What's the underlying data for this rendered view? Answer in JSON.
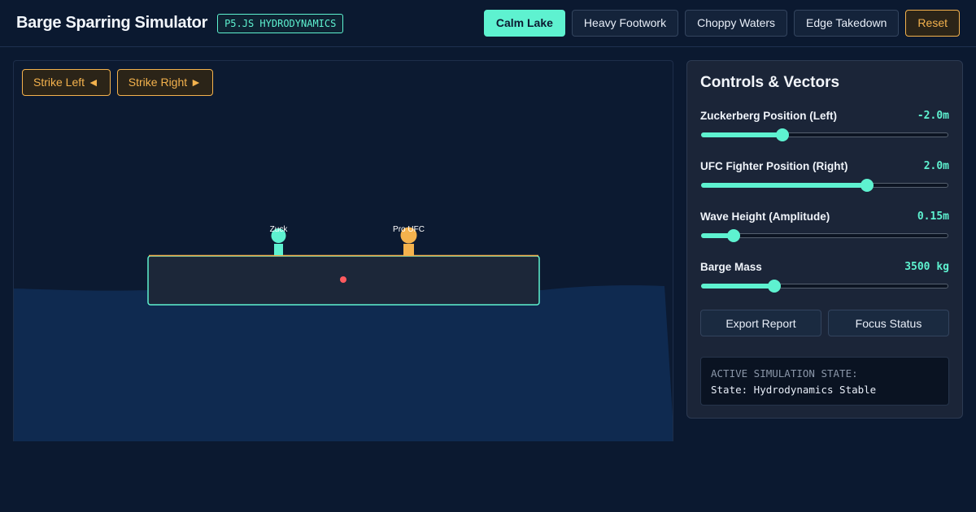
{
  "header": {
    "title": "Barge Sparring Simulator",
    "tag": "P5.JS HYDRODYNAMICS",
    "nav": [
      "Calm Lake",
      "Heavy Footwork",
      "Choppy Waters",
      "Edge Takedown",
      "Reset"
    ]
  },
  "stage": {
    "strike_left": "Strike Left ◄",
    "strike_right": "Strike Right ►",
    "fighter_left_label": "Zuck",
    "fighter_right_label": "Pro UFC",
    "colors": {
      "water": "#0f2a50",
      "barge": "#1c2739",
      "barge_outline": "#5ef2d0",
      "deck": "#f4b24d",
      "left_fighter": "#5ef2d0",
      "right_fighter": "#f4b24d",
      "center_of_mass": "#ff5a5f"
    }
  },
  "panel": {
    "title": "Controls & Vectors",
    "controls": [
      {
        "label": "Zuckerberg Position (Left)",
        "value": "-2.0m",
        "fraction": 0.32
      },
      {
        "label": "UFC Fighter Position (Right)",
        "value": "2.0m",
        "fraction": 0.68
      },
      {
        "label": "Wave Height (Amplitude)",
        "value": "0.15m",
        "fraction": 0.115
      },
      {
        "label": "Barge Mass",
        "value": "3500 kg",
        "fraction": 0.285
      }
    ],
    "export_label": "Export Report",
    "focus_label": "Focus Status",
    "state_title": "ACTIVE SIMULATION STATE:",
    "state_text": "State: Hydrodynamics Stable"
  }
}
